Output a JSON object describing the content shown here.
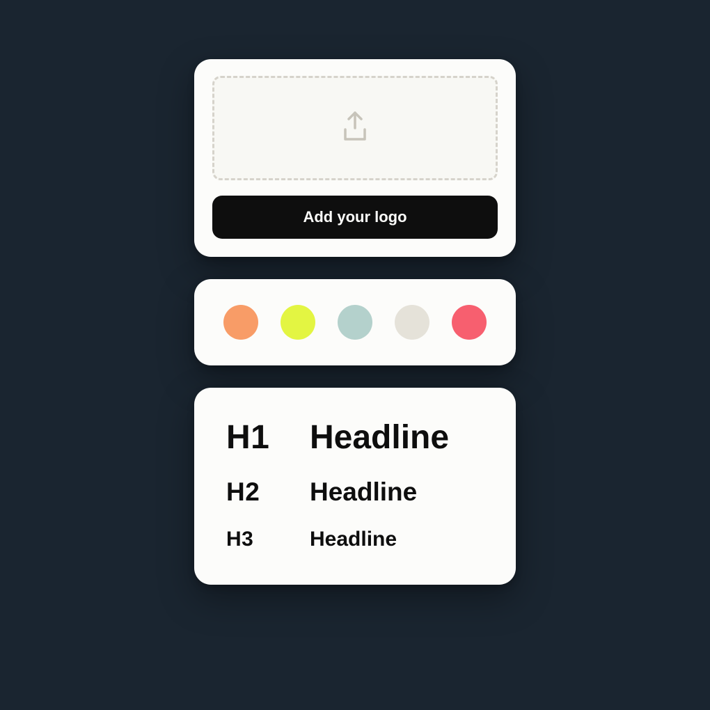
{
  "logo_card": {
    "button_label": "Add your logo"
  },
  "colors": {
    "swatches": [
      "#f89c67",
      "#e3f542",
      "#b4d1cc",
      "#e5e2d9",
      "#f75f6f"
    ]
  },
  "typography": {
    "rows": [
      {
        "tag": "H1",
        "label": "Headline"
      },
      {
        "tag": "H2",
        "label": "Headline"
      },
      {
        "tag": "H3",
        "label": "Headline"
      }
    ]
  }
}
